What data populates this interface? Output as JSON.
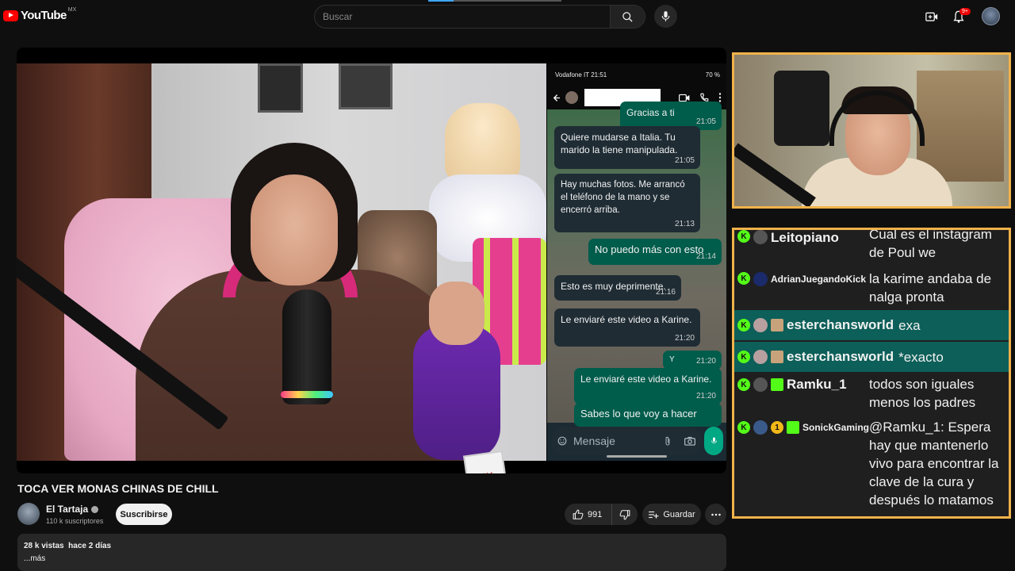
{
  "app": {
    "logo_text": "YouTube",
    "region": "MX"
  },
  "search": {
    "placeholder": "Buscar"
  },
  "notifications": {
    "badge": "9+"
  },
  "phone": {
    "carrier_time": "Vodafone IT 21:51",
    "battery": "70 %",
    "input_placeholder": "Mensaje",
    "messages": [
      {
        "dir": "out",
        "text": "Gracias a ti",
        "time": "21:05"
      },
      {
        "dir": "in",
        "text": "Quiere mudarse a Italia. Tu marido la tiene manipulada.",
        "time": "21:05"
      },
      {
        "dir": "in",
        "text": "Hay muchas fotos. Me arrancó el teléfono de la mano y se encerró arriba.",
        "time": "21:13"
      },
      {
        "dir": "out",
        "text": "No puedo más con esto",
        "time": "21:14"
      },
      {
        "dir": "in",
        "text": "Esto es muy deprimente.",
        "time": "21:16"
      },
      {
        "dir": "in",
        "text": "Le enviaré este video a Karine.",
        "time": "21:20"
      },
      {
        "dir": "out",
        "text": "Y",
        "time": "21:20"
      },
      {
        "dir": "out",
        "text": "Le enviaré este video a Karine.",
        "time": "21:20"
      },
      {
        "dir": "out",
        "text": "Sabes lo que voy a hacer",
        "time": ""
      }
    ]
  },
  "video": {
    "title": "TOCA VER MONAS CHINAS DE CHILL",
    "channel": "El Tartaja",
    "subscribers": "110 k suscriptores",
    "subscribe_label": "Suscribirse",
    "likes": "991",
    "save_label": "Guardar",
    "views": "28 k vistas",
    "age": "hace 2 días",
    "more": "...más"
  },
  "live_chat": [
    {
      "user": "Leitopiano",
      "message": "Cual es el instagram de Poul we",
      "highlight": false,
      "badges": []
    },
    {
      "user": "AdrianJuegandoKick",
      "message": "la karime andaba de nalga pronta",
      "highlight": false,
      "badges": []
    },
    {
      "user": "esterchansworld",
      "message": "exa",
      "highlight": true,
      "badges": [
        "sub"
      ]
    },
    {
      "user": "esterchansworld",
      "message": "*exacto",
      "highlight": true,
      "badges": [
        "sub"
      ]
    },
    {
      "user": "Ramku_1",
      "message": "todos son iguales menos los padres",
      "highlight": false,
      "badges": [
        "sub"
      ]
    },
    {
      "user": "SonickGaming",
      "message": "@Ramku_1: Espera hay que mantenerlo vivo para encontrar la clave de la cura y después lo matamos",
      "highlight": false,
      "badges": [
        "one",
        "sub"
      ]
    }
  ],
  "icons": [
    "search-icon",
    "mic-icon",
    "create-icon",
    "bell-icon",
    "thumb-up-icon",
    "thumb-down-icon",
    "playlist-add-icon",
    "more-icon",
    "kick-icon"
  ],
  "colors": {
    "accent": "#ff0000",
    "kick": "#53fc18",
    "frame": "#f0b24a",
    "highlight": "#0d5f59"
  }
}
